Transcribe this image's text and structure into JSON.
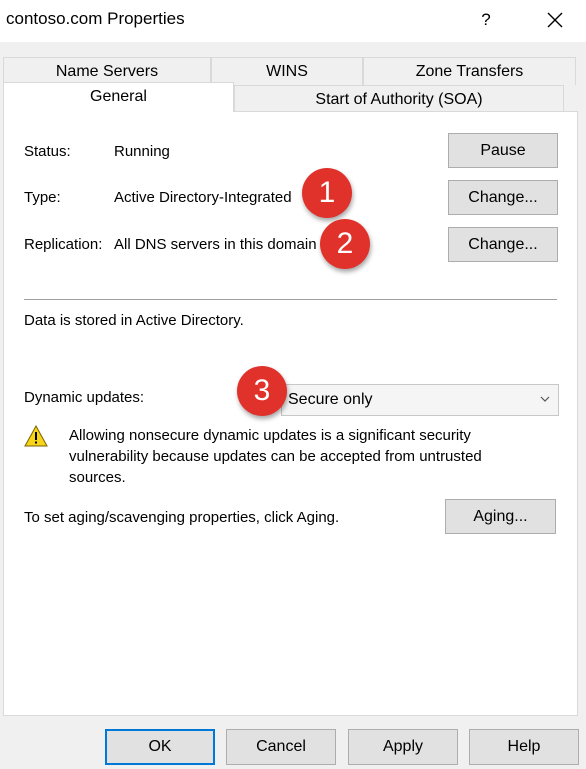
{
  "window": {
    "title": "contoso.com Properties",
    "help_label": "?",
    "close_icon": "close-icon"
  },
  "tabs": {
    "row1": [
      "Name Servers",
      "WINS",
      "Zone Transfers"
    ],
    "row2": [
      "General",
      "Start of Authority (SOA)"
    ],
    "active": "General"
  },
  "general": {
    "status_label": "Status:",
    "status_value": "Running",
    "pause_label": "Pause",
    "type_label": "Type:",
    "type_value": "Active Directory-Integrated",
    "change_label": "Change...",
    "replication_label": "Replication:",
    "replication_value": "All DNS servers in this domain",
    "storage_note": "Data is stored in Active Directory.",
    "dynamic_label": "Dynamic updates:",
    "dynamic_value": "Secure only",
    "warning_text": "Allowing nonsecure dynamic updates is a significant security vulnerability because updates can be accepted from untrusted sources.",
    "aging_note": "To set aging/scavenging properties, click Aging.",
    "aging_label": "Aging..."
  },
  "callouts": [
    "1",
    "2",
    "3"
  ],
  "footer": {
    "ok": "OK",
    "cancel": "Cancel",
    "apply": "Apply",
    "help": "Help"
  },
  "colors": {
    "callout": "#e0312b",
    "default_button_border": "#0078d7",
    "warning": "#f7d417"
  }
}
